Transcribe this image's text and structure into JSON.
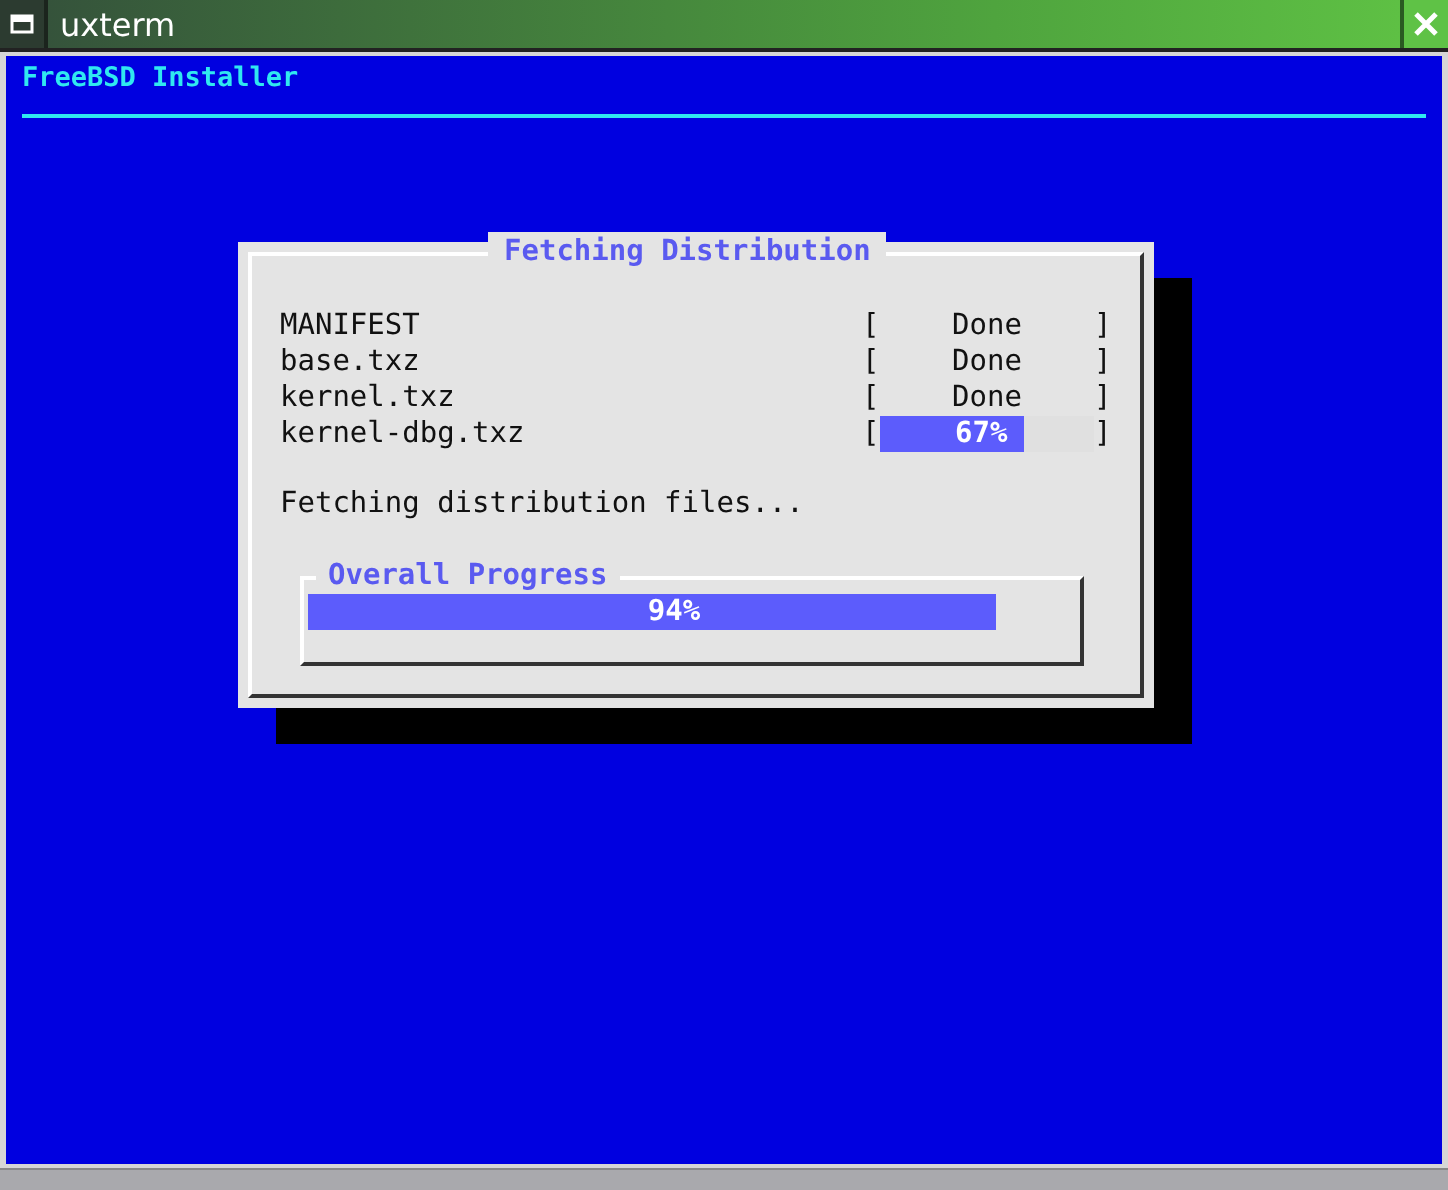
{
  "window": {
    "title": "uxterm"
  },
  "header": {
    "title": "FreeBSD Installer"
  },
  "dialog": {
    "title": "Fetching Distribution",
    "files": [
      {
        "name": "MANIFEST",
        "open": "[",
        "kind": "done",
        "status": "Done",
        "close": "]"
      },
      {
        "name": "base.txz",
        "open": "[",
        "kind": "done",
        "status": "Done",
        "close": "]"
      },
      {
        "name": "kernel.txz",
        "open": "[",
        "kind": "done",
        "status": "Done",
        "close": "]"
      },
      {
        "name": "kernel-dbg.txz",
        "open": "[",
        "kind": "progress",
        "status": "67%",
        "level": 0.67,
        "close": "]"
      }
    ],
    "message": "Fetching distribution files...",
    "overall": {
      "label": "Overall Progress",
      "reading": "94%",
      "level": 0.94
    }
  }
}
